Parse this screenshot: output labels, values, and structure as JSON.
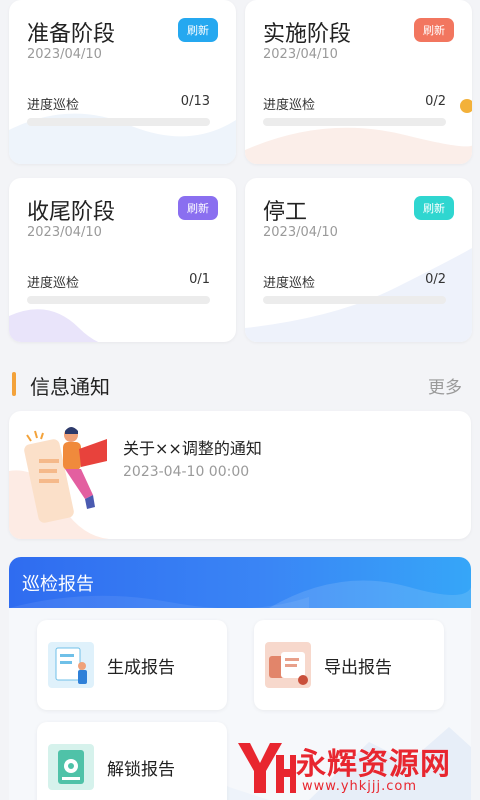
{
  "stages": [
    {
      "title": "准备阶段",
      "date": "2023/04/10",
      "badge": "刷新",
      "badge_color": "#25a8f0",
      "progress_label": "进度巡检",
      "progress_value": "0/13",
      "progress_fraction": 0
    },
    {
      "title": "实施阶段",
      "date": "2023/04/10",
      "badge": "刷新",
      "badge_color": "#f2765f",
      "progress_label": "进度巡检",
      "progress_value": "0/2",
      "progress_fraction": 0
    },
    {
      "title": "收尾阶段",
      "date": "2023/04/10",
      "badge": "刷新",
      "badge_color": "#8a6ff0",
      "progress_label": "进度巡检",
      "progress_value": "0/1",
      "progress_fraction": 0
    },
    {
      "title": "停工",
      "date": "2023/04/10",
      "badge": "刷新",
      "badge_color": "#2fd6d0",
      "progress_label": "进度巡检",
      "progress_value": "0/2",
      "progress_fraction": 0
    }
  ],
  "notices": {
    "section_title": "信息通知",
    "more_label": "更多",
    "items": [
      {
        "title": "关于××调整的通知",
        "time": "2023-04-10 00:00"
      }
    ]
  },
  "report": {
    "title": "巡检报告",
    "buttons": [
      {
        "label": "生成报告",
        "icon": "document-person-icon"
      },
      {
        "label": "导出报告",
        "icon": "export-report-icon"
      },
      {
        "label": "解锁报告",
        "icon": "unlock-report-icon"
      }
    ]
  },
  "watermark": {
    "text": "永辉资源网",
    "url": "www.yhkjjj.com"
  },
  "colors": {
    "accent": "#f3a23a",
    "header_blue": "#2f6cf0",
    "track": "#ececec"
  }
}
